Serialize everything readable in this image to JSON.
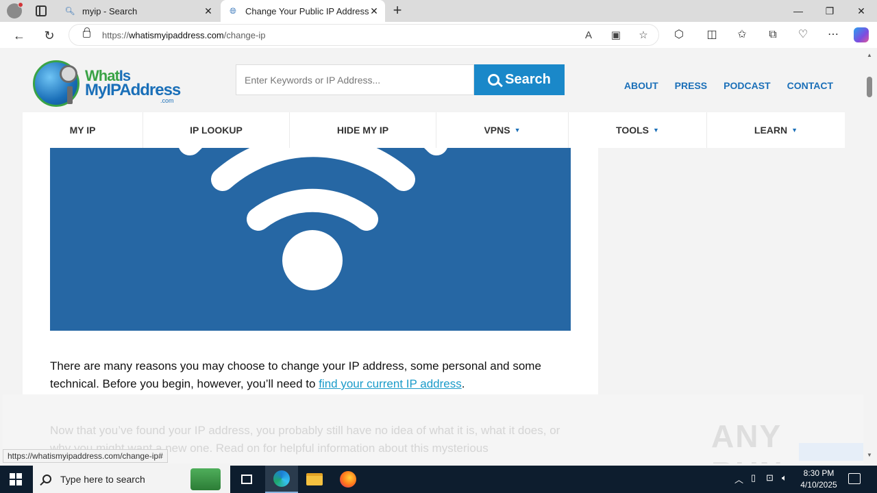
{
  "browser": {
    "tabs": [
      {
        "label": "myip - Search",
        "icon": "search-icon"
      },
      {
        "label": "Change Your Public IP Address: T",
        "icon": "globe-icon",
        "active": true
      }
    ],
    "address": {
      "scheme": "https://",
      "host": "whatismyipaddress.com",
      "path": "/change-ip"
    },
    "status_url": "https://whatismyipaddress.com/change-ip#"
  },
  "site": {
    "logo": {
      "line1_a": "What",
      "line1_b": "Is",
      "line2_a": "My",
      "line2_b": "IPAddress",
      "suffix": ".com"
    },
    "search": {
      "placeholder": "Enter Keywords or IP Address...",
      "button_label": "Search"
    },
    "top_links": [
      "ABOUT",
      "PRESS",
      "PODCAST",
      "CONTACT"
    ],
    "nav": [
      {
        "label": "MY IP",
        "dropdown": false
      },
      {
        "label": "IP LOOKUP",
        "dropdown": false
      },
      {
        "label": "HIDE MY IP",
        "dropdown": false
      },
      {
        "label": "VPNS",
        "dropdown": true
      },
      {
        "label": "TOOLS",
        "dropdown": true
      },
      {
        "label": "LEARN",
        "dropdown": true
      }
    ],
    "hero_color": "#2667a4",
    "para1": {
      "before": "There are many reasons you may choose to change your IP address, some personal and some technical. Before you begin, however, you’ll need to ",
      "link": "find your current IP address",
      "after": "."
    },
    "para2": "Now that you’ve found your IP address, you probably still have no idea of what it is, what it does, or why you might want a new one.  Read on for helpful information about this mysterious"
  },
  "watermark": "ANY RUN",
  "taskbar": {
    "search_placeholder": "Type here to search",
    "time": "8:30 PM",
    "date": "4/10/2025"
  }
}
